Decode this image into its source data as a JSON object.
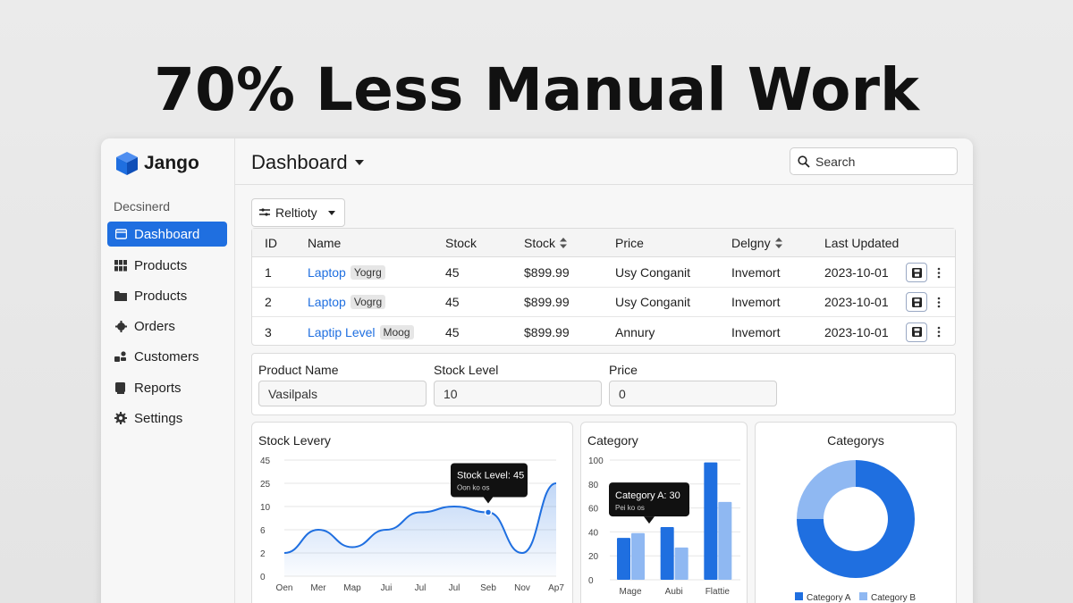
{
  "headline": "70% Less Manual Work",
  "app": {
    "logo": "Jango",
    "sidebar_section": "Decsinerd",
    "nav": [
      {
        "label": "Dashboard",
        "icon": "dashboard-icon",
        "active": true
      },
      {
        "label": "Products",
        "icon": "grid-icon",
        "active": false
      },
      {
        "label": "Products",
        "icon": "folder-icon",
        "active": false
      },
      {
        "label": "Orders",
        "icon": "gear-small-icon",
        "active": false
      },
      {
        "label": "Customers",
        "icon": "users-icon",
        "active": false
      },
      {
        "label": "Reports",
        "icon": "report-icon",
        "active": false
      },
      {
        "label": "Settings",
        "icon": "settings-icon",
        "active": false
      }
    ]
  },
  "topbar": {
    "title": "Dashboard",
    "search_placeholder": "Search"
  },
  "filter": {
    "label": "Reltioty"
  },
  "table": {
    "headers": [
      "ID",
      "Name",
      "Stock",
      "Stock",
      "Price",
      "Delgny",
      "Last Updated"
    ],
    "rows": [
      {
        "id": "1",
        "name": "Laptop",
        "tag": "Yogrg",
        "stock": "45",
        "price": "$899.99",
        "supplier": "Usy Conganit",
        "category": "Invemort",
        "updated": "2023-10-01"
      },
      {
        "id": "2",
        "name": "Laptop",
        "tag": "Vogrg",
        "stock": "45",
        "price": "$899.99",
        "supplier": "Usy Conganit",
        "category": "Invemort",
        "updated": "2023-10-01"
      },
      {
        "id": "3",
        "name": "Laptip Level",
        "tag": "Moog",
        "stock": "45",
        "price": "$899.99",
        "supplier": "Annury",
        "category": "Invemort",
        "updated": "2023-10-01"
      }
    ]
  },
  "form": {
    "product_name_label": "Product Name",
    "product_name_value": "Vasilpals",
    "stock_label": "Stock Level",
    "stock_value": "10",
    "price_label": "Price",
    "price_value": "0"
  },
  "chart_data": [
    {
      "type": "area",
      "title": "Stock Levery",
      "y_ticks": [
        "45",
        "25",
        "10",
        "6",
        "2",
        "0"
      ],
      "categories": [
        "Oen",
        "Mer",
        "Map",
        "Jui",
        "Jul",
        "Jul",
        "Seb",
        "Nov",
        "Ap7"
      ],
      "values": [
        2,
        6,
        3,
        6,
        9,
        10,
        9,
        2,
        25
      ],
      "tooltip": {
        "title": "Stock Level: 45",
        "sub": "Oon ko os"
      }
    },
    {
      "type": "bar",
      "title": "Category",
      "ylim": [
        0,
        100
      ],
      "y_ticks": [
        "100",
        "80",
        "60",
        "40",
        "20",
        "0"
      ],
      "categories": [
        "Mage",
        "Aubi",
        "Flattie"
      ],
      "series": [
        {
          "name": "Category A",
          "values": [
            35,
            44,
            98
          ],
          "color": "#1f6fe0"
        },
        {
          "name": "Category B",
          "values": [
            39,
            27,
            65
          ],
          "color": "#8fb8f2"
        }
      ],
      "tooltip": {
        "title": "Category A: 30",
        "sub": "Pei ko os"
      }
    },
    {
      "type": "pie",
      "title": "Categorys",
      "slices": [
        {
          "label": "Category A",
          "value": 75,
          "color": "#1f6fe0"
        },
        {
          "label": "Category B",
          "value": 25,
          "color": "#8fb8f2"
        }
      ],
      "legend": "bottom"
    }
  ]
}
